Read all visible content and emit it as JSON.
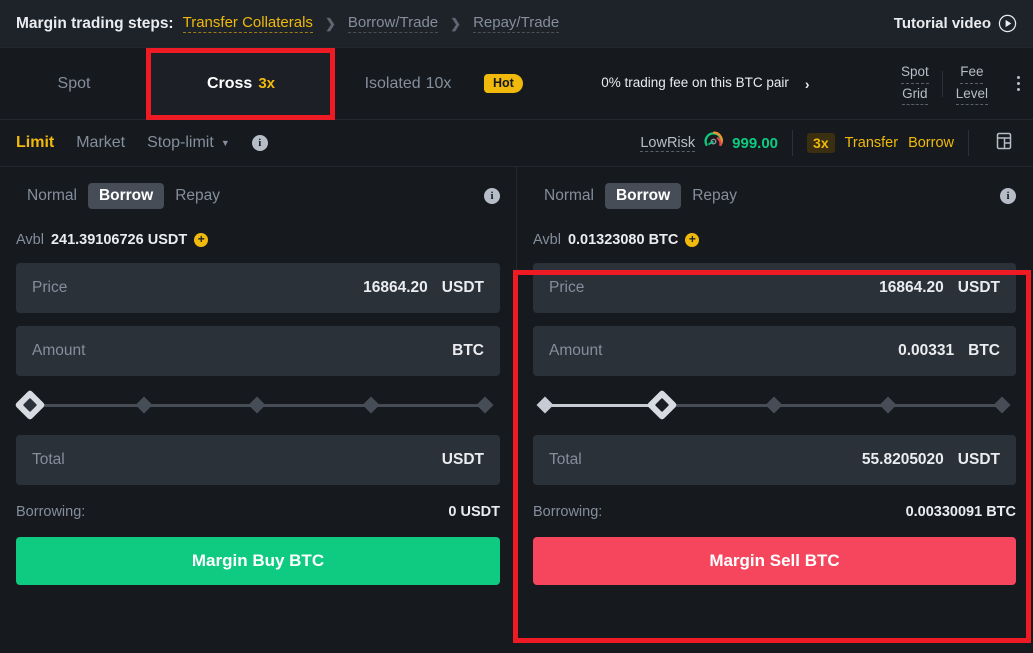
{
  "steps_bar": {
    "label": "Margin trading steps:",
    "steps": [
      {
        "text": "Transfer Collaterals",
        "state": "active"
      },
      {
        "text": "Borrow/Trade",
        "state": "dim"
      },
      {
        "text": "Repay/Trade",
        "state": "dim"
      }
    ],
    "separator": "❯",
    "tutorial_label": "Tutorial video",
    "play_icon": "play-circle-icon",
    "active_color": "#f0b90b"
  },
  "mode_tabs": {
    "spot": {
      "label": "Spot"
    },
    "cross": {
      "label": "Cross",
      "leverage": "3x",
      "active": true,
      "accent": "#c9a227"
    },
    "isolated": {
      "label": "Isolated",
      "leverage": "10x"
    },
    "hot_badge": "Hot",
    "fee_promo": {
      "text": "0% trading fee on this BTC pair",
      "chevron": "›"
    },
    "links": [
      {
        "line1": "Spot",
        "line2": "Grid"
      },
      {
        "line1": "Fee",
        "line2": "Level"
      }
    ],
    "more_icon": "kebab-menu-icon"
  },
  "order_type_bar": {
    "types": [
      {
        "label": "Limit",
        "active": true
      },
      {
        "label": "Market",
        "active": false
      },
      {
        "label": "Stop-limit",
        "active": false,
        "has_caret": true
      }
    ],
    "info_icon": "info-icon",
    "risk": {
      "label": "LowRisk",
      "gauge_icon": "risk-gauge-icon",
      "value": "999.00",
      "value_color": "#0ecb81"
    },
    "leverage_badge": "3x",
    "transfer_label": "Transfer",
    "borrow_label": "Borrow",
    "layout_icon": "layout-grid-icon"
  },
  "buy_panel": {
    "side": "buy",
    "tabs": [
      {
        "label": "Normal",
        "active": false
      },
      {
        "label": "Borrow",
        "active": true
      },
      {
        "label": "Repay",
        "active": false
      }
    ],
    "info_icon": "info-icon",
    "available": {
      "label": "Avbl",
      "value": "241.39106726 USDT",
      "add_icon": "add-funds-icon"
    },
    "price": {
      "label": "Price",
      "value": "16864.20",
      "unit": "USDT"
    },
    "amount": {
      "label": "Amount",
      "value": "",
      "unit": "BTC"
    },
    "slider": {
      "percent": 0,
      "stops": [
        0,
        25,
        50,
        75,
        100
      ]
    },
    "total": {
      "label": "Total",
      "value": "",
      "unit": "USDT"
    },
    "borrowing": {
      "label": "Borrowing:",
      "value": "0 USDT"
    },
    "action": {
      "label": "Margin Buy BTC",
      "color": "#0ecb81"
    }
  },
  "sell_panel": {
    "side": "sell",
    "tabs": [
      {
        "label": "Normal",
        "active": false
      },
      {
        "label": "Borrow",
        "active": true
      },
      {
        "label": "Repay",
        "active": false
      }
    ],
    "info_icon": "info-icon",
    "available": {
      "label": "Avbl",
      "value": "0.01323080 BTC",
      "add_icon": "add-funds-icon"
    },
    "price": {
      "label": "Price",
      "value": "16864.20",
      "unit": "USDT"
    },
    "amount": {
      "label": "Amount",
      "value": "0.00331",
      "unit": "BTC"
    },
    "slider": {
      "percent": 25,
      "stops": [
        0,
        25,
        50,
        75,
        100
      ]
    },
    "total": {
      "label": "Total",
      "value": "55.8205020",
      "unit": "USDT"
    },
    "borrowing": {
      "label": "Borrowing:",
      "value": "0.00330091 BTC"
    },
    "action": {
      "label": "Margin Sell BTC",
      "color": "#f6465d"
    }
  },
  "annotations": {
    "color": "#ee1b24",
    "boxes": [
      {
        "name": "cross-tab-highlight"
      },
      {
        "name": "sell-panel-highlight"
      }
    ]
  }
}
